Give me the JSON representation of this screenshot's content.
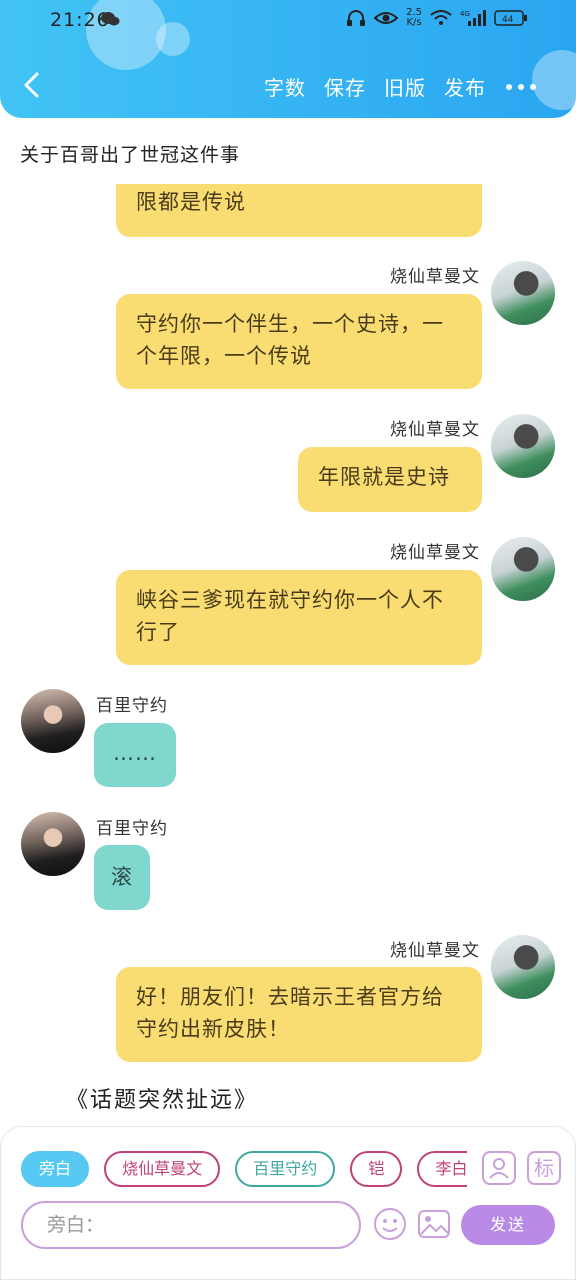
{
  "status": {
    "time": "21:26",
    "net_speed_top": "2.5",
    "net_speed_bottom": "K/s",
    "network": "4G",
    "battery": "44"
  },
  "nav": {
    "back_icon": "chevron-left-icon",
    "actions": [
      "字数",
      "保存",
      "旧版",
      "发布"
    ],
    "more_icon": "more-dots-icon"
  },
  "chat_title": "关于百哥出了世冠这件事",
  "messages": [
    {
      "side": "right",
      "name": "",
      "text": "限都是传说",
      "color": "yellow"
    },
    {
      "side": "right",
      "name": "烧仙草曼文",
      "text": "守约你一个伴生，一个史诗，一个年限，一个传说",
      "color": "yellow"
    },
    {
      "side": "right",
      "name": "烧仙草曼文",
      "text": "年限就是史诗",
      "color": "yellow"
    },
    {
      "side": "right",
      "name": "烧仙草曼文",
      "text": "峡谷三爹现在就守约你一个人不行了",
      "color": "yellow"
    },
    {
      "side": "left",
      "name": "百里守约",
      "text": "……",
      "color": "teal"
    },
    {
      "side": "left",
      "name": "百里守约",
      "text": "滚",
      "color": "teal"
    },
    {
      "side": "right",
      "name": "烧仙草曼文",
      "text": "好！朋友们！去暗示王者官方给守约出新皮肤！",
      "color": "yellow"
    }
  ],
  "topic_line": "《话题突然扯远》",
  "composer": {
    "chips": [
      "旁白",
      "烧仙草曼文",
      "百里守约",
      "铠",
      "李白"
    ],
    "input_placeholder": "旁白：",
    "send_label": "发送",
    "person_icon": "person-card-icon",
    "tag_icon_label": "标",
    "emoji_icon": "emoji-icon",
    "image_icon": "image-icon"
  },
  "colors": {
    "header": "#2aa6f1",
    "yellow_bubble": "#fadd72",
    "teal_bubble": "#7fd7cd",
    "accent_purple": "#b98ae6"
  }
}
